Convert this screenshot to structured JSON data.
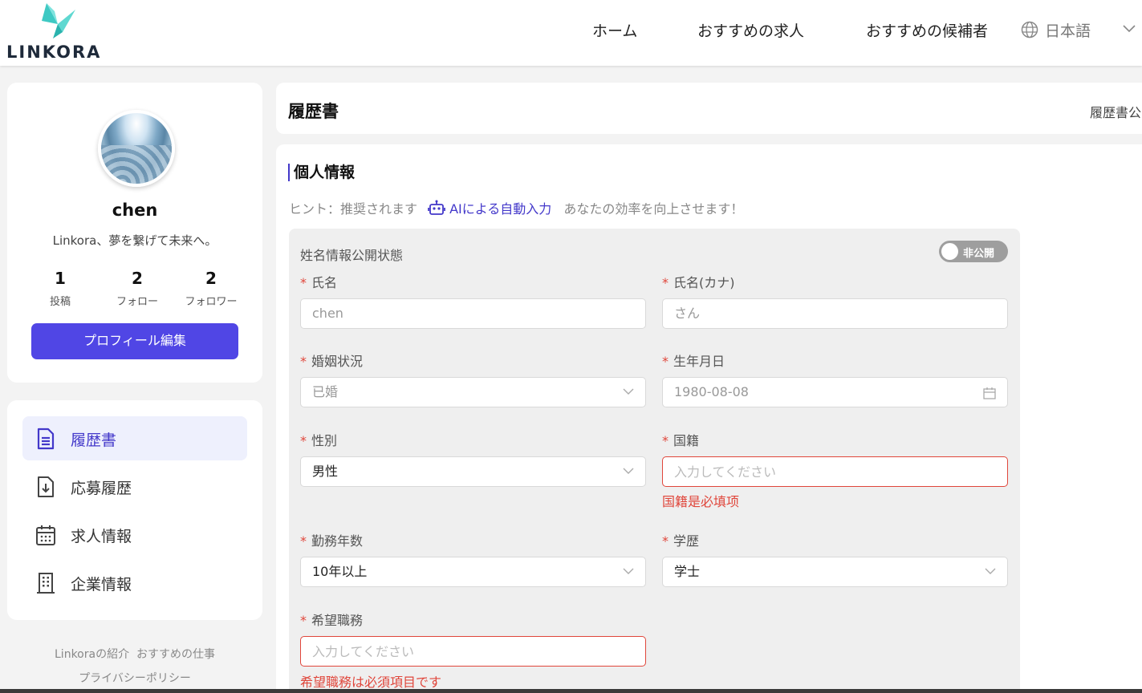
{
  "header": {
    "logo_text": "LINKORA",
    "nav": [
      "ホーム",
      "おすすめの求人",
      "おすすめの候補者"
    ],
    "language": "日本語",
    "brand_color": "#3ec9c3"
  },
  "profile": {
    "username": "chen",
    "tagline": "Linkora、夢を繋げて未来へ。",
    "stats": [
      {
        "value": "1",
        "label": "投稿"
      },
      {
        "value": "2",
        "label": "フォロー"
      },
      {
        "value": "2",
        "label": "フォロワー"
      }
    ],
    "edit_label": "プロフィール編集",
    "accent": "#5046e5"
  },
  "menu": {
    "items": [
      {
        "label": "履歴書",
        "icon": "document-icon",
        "active": true
      },
      {
        "label": "応募履歴",
        "icon": "download-doc-icon",
        "active": false
      },
      {
        "label": "求人情報",
        "icon": "calendar-icon",
        "active": false
      },
      {
        "label": "企業情報",
        "icon": "building-icon",
        "active": false
      }
    ]
  },
  "footer": {
    "links": [
      "Linkoraの紹介",
      "おすすめの仕事",
      "プライバシーポリシー"
    ]
  },
  "resume": {
    "title": "履歴書",
    "right_text": "履歴書公"
  },
  "form": {
    "section_title": "個人情報",
    "hint_prefix": "ヒント：推奨されます",
    "hint_ai": "AIによる自動入力",
    "hint_suffix": "あなたの効率を向上させます！",
    "visibility_label": "姓名情報公開状態",
    "visibility_toggle": "非公開",
    "fields": {
      "name": {
        "label": "氏名",
        "value": "chen"
      },
      "kana": {
        "label": "氏名(カナ)",
        "value": "さん"
      },
      "marital": {
        "label": "婚姻状況",
        "value": "已婚"
      },
      "birth": {
        "label": "生年月日",
        "value": "1980-08-08"
      },
      "gender": {
        "label": "性別",
        "value": "男性"
      },
      "nationality": {
        "label": "国籍",
        "placeholder": "入力してください",
        "error": "国籍是必填项"
      },
      "years": {
        "label": "勤務年数",
        "value": "10年以上"
      },
      "education": {
        "label": "学歴",
        "value": "学士"
      },
      "desired_job": {
        "label": "希望職務",
        "placeholder": "入力してください",
        "error": "希望職務は必須項目です"
      }
    },
    "required_mark": "*",
    "error_color": "#e0463b"
  }
}
